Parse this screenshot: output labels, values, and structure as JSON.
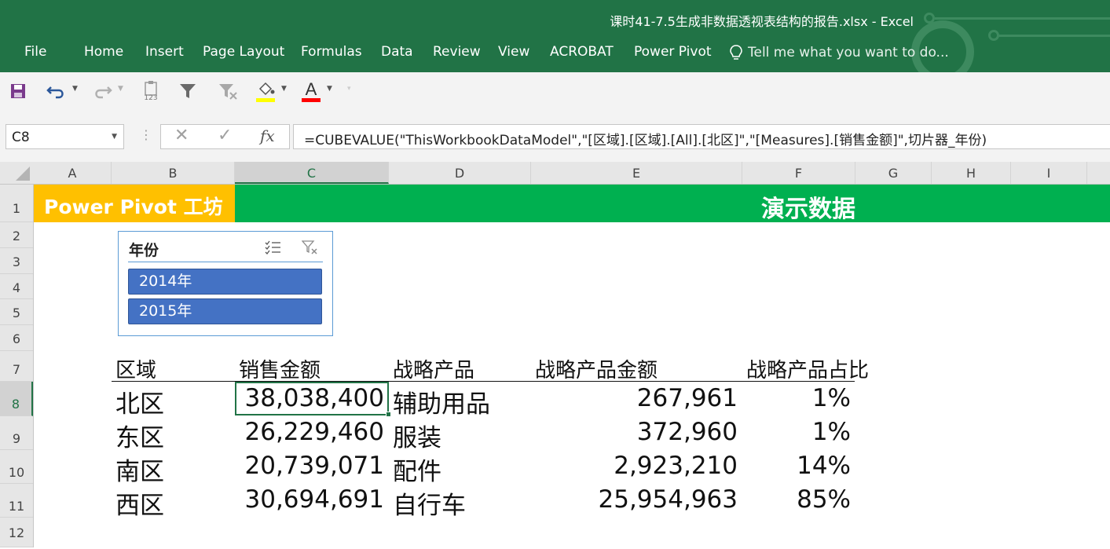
{
  "window": {
    "title": "课时41-7.5生成非数据透视表结构的报告.xlsx - Excel"
  },
  "ribbon": {
    "tabs": [
      {
        "label": "File"
      },
      {
        "label": "Home"
      },
      {
        "label": "Insert"
      },
      {
        "label": "Page Layout"
      },
      {
        "label": "Formulas"
      },
      {
        "label": "Data"
      },
      {
        "label": "Review"
      },
      {
        "label": "View"
      },
      {
        "label": "ACROBAT"
      },
      {
        "label": "Power Pivot"
      }
    ],
    "tell_me": "Tell me what you want to do..."
  },
  "quick_access": {
    "icons": [
      "save-icon",
      "undo-icon",
      "redo-icon",
      "paste-values-icon",
      "filter-icon",
      "clear-filter-icon",
      "fill-color-icon",
      "font-color-icon"
    ],
    "fill_color": "#ffff00",
    "font_color": "#ff0000",
    "paste_values_label": "123"
  },
  "formula_bar": {
    "name_box": "C8",
    "fx_label": "fx",
    "formula": "=CUBEVALUE(\"ThisWorkbookDataModel\",\"[区域].[区域].[All].[北区]\",\"[Measures].[销售金额]\",切片器_年份)"
  },
  "grid": {
    "columns": [
      "A",
      "B",
      "C",
      "D",
      "E",
      "F",
      "G",
      "H",
      "I"
    ],
    "rows": [
      "1",
      "2",
      "3",
      "4",
      "5",
      "6",
      "7",
      "8",
      "9",
      "10",
      "11",
      "12"
    ],
    "selected_column": "C",
    "selected_row": "8"
  },
  "banner": {
    "left_text": "Power Pivot 工坊",
    "left_color": "#ffc000",
    "right_text": "演示数据",
    "right_color": "#00b050"
  },
  "slicer": {
    "title": "年份",
    "items": [
      {
        "label": "2014年"
      },
      {
        "label": "2015年"
      }
    ],
    "icons": [
      "multi-select-icon",
      "clear-filter-icon"
    ]
  },
  "table": {
    "headers": [
      "区域",
      "销售金额",
      "战略产品",
      "战略产品金额",
      "战略产品占比"
    ],
    "rows": [
      {
        "region": "北区",
        "sales": "38,038,400",
        "product": "辅助用品",
        "product_sales": "267,961",
        "share": "1%"
      },
      {
        "region": "东区",
        "sales": "26,229,460",
        "product": "服装",
        "product_sales": "372,960",
        "share": "1%"
      },
      {
        "region": "南区",
        "sales": "20,739,071",
        "product": "配件",
        "product_sales": "2,923,210",
        "share": "14%"
      },
      {
        "region": "西区",
        "sales": "30,694,691",
        "product": "自行车",
        "product_sales": "25,954,963",
        "share": "85%"
      }
    ]
  },
  "colors": {
    "excel_green": "#217346",
    "slicer_blue": "#4472c4"
  }
}
